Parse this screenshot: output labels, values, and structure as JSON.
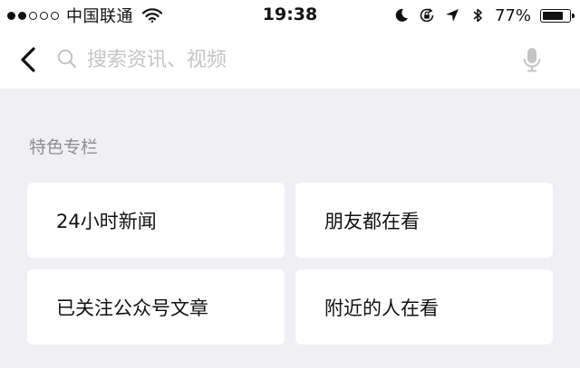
{
  "status_bar": {
    "carrier": "中国联通",
    "time": "19:38",
    "battery_percent": "77%",
    "battery_level": 0.77,
    "signal_bars_filled": 2,
    "signal_bars_total": 5,
    "icons": [
      "wifi-icon",
      "moon-icon",
      "rotation-lock-icon",
      "location-arrow-icon",
      "bluetooth-icon",
      "battery-icon"
    ]
  },
  "header": {
    "search_placeholder": "搜索资讯、视频",
    "search_value": "",
    "icons": [
      "back-chevron-icon",
      "search-icon",
      "microphone-icon"
    ]
  },
  "main": {
    "section_title": "特色专栏",
    "columns": [
      {
        "label": "24小时新闻"
      },
      {
        "label": "朋友都在看"
      },
      {
        "label": "已关注公众号文章"
      },
      {
        "label": "附近的人在看"
      }
    ]
  },
  "colors": {
    "background": "#efeff4",
    "card": "#ffffff",
    "section_title": "#8e8e93",
    "placeholder": "#c4c4c4"
  }
}
